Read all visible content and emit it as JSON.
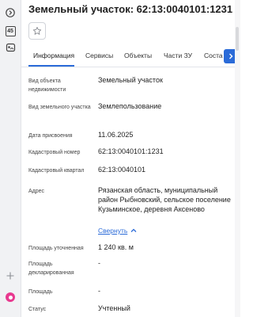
{
  "rail": {
    "icons": [
      "chevron-right-icon",
      "badge-45-icon",
      "map-layers-icon",
      "plus-icon",
      "assistant-icon"
    ],
    "badge_text": "45",
    "accent_color": "#e8398f"
  },
  "page": {
    "title": "Земельный участок: 62:13:0040101:1231"
  },
  "tabs": [
    {
      "label": "Информация",
      "active": true
    },
    {
      "label": "Сервисы",
      "active": false
    },
    {
      "label": "Объекты",
      "active": false
    },
    {
      "label": "Части ЗУ",
      "active": false
    },
    {
      "label": "Соста",
      "active": false
    }
  ],
  "accent_color": "#2b6bd8",
  "fields": {
    "object_type": {
      "label": "Вид объекта недвижимости",
      "value": "Земельный участок"
    },
    "land_type": {
      "label": "Вид земельного участка",
      "value": "Землепользование"
    },
    "assign_date": {
      "label": "Дата присвоения",
      "value": "11.06.2025"
    },
    "cadastral_number": {
      "label": "Кадастровый номер",
      "value": "62:13:0040101:1231"
    },
    "cadastral_quarter": {
      "label": "Кадастровый квартал",
      "value": "62:13:0040101"
    },
    "address": {
      "label": "Адрес",
      "value": "Рязанская область, муниципальный район Рыбновский, сельское поселение Кузьминское, деревня Аксеново",
      "collapse_label": "Свернуть"
    },
    "area_specified": {
      "label": "Площадь уточненная",
      "value": "1 240 кв. м"
    },
    "area_declared": {
      "label": "Площадь декларированная",
      "value": "-"
    },
    "area": {
      "label": "Площадь",
      "value": "-"
    },
    "status": {
      "label": "Статус",
      "value": "Учтенный"
    }
  }
}
